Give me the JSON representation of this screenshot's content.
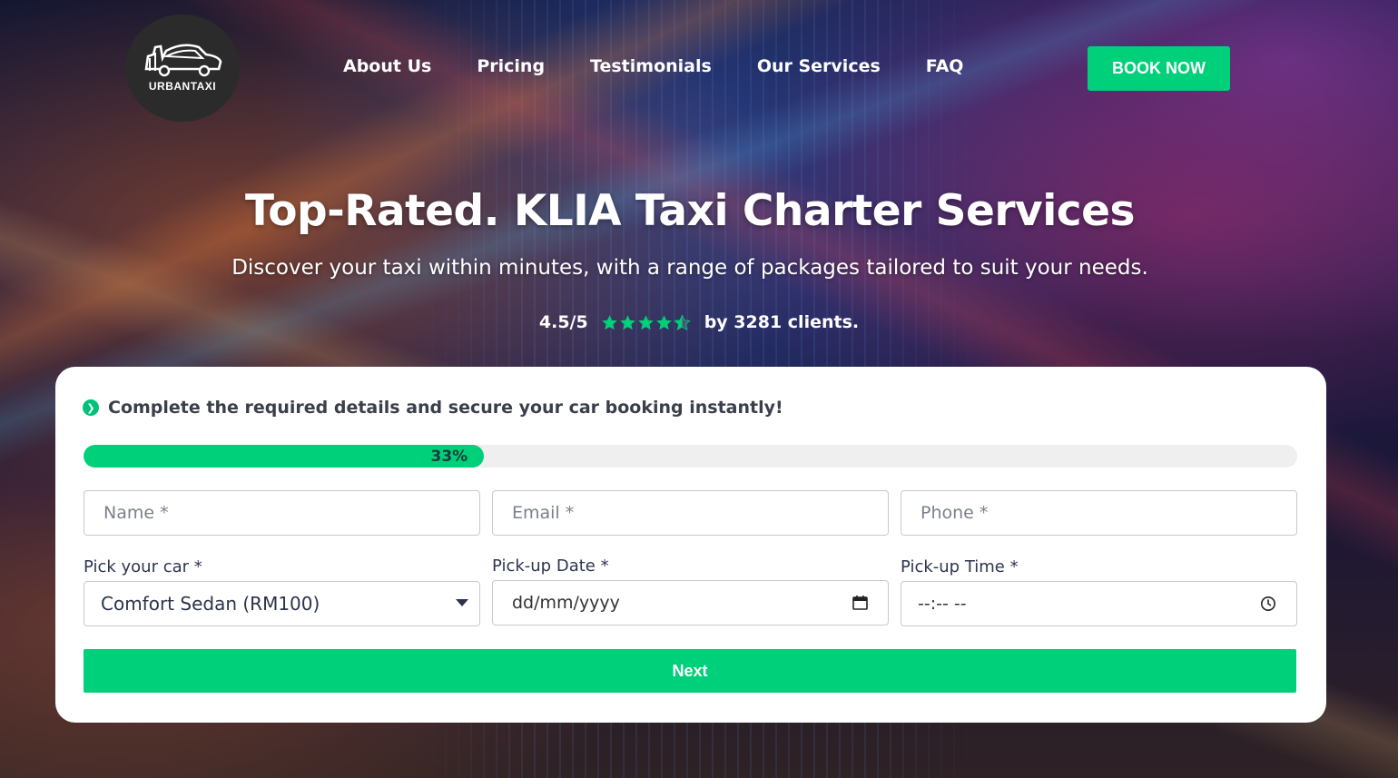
{
  "brand": {
    "logo_text": "URBANTAXI"
  },
  "nav": {
    "items": [
      {
        "label": "About Us"
      },
      {
        "label": "Pricing"
      },
      {
        "label": "Testimonials"
      },
      {
        "label": "Our Services"
      },
      {
        "label": "FAQ"
      }
    ],
    "cta_label": "BOOK NOW"
  },
  "hero": {
    "title": "Top-Rated. KLIA Taxi Charter Services",
    "subtitle": "Discover your taxi within minutes, with a range of packages tailored to suit your needs.",
    "rating_score": "4.5/5",
    "rating_stars": 4.5,
    "rating_text": "by 3281 clients."
  },
  "form": {
    "notice": "Complete the required details and secure your car booking instantly!",
    "progress_label": "33%",
    "progress_value": 33,
    "name_placeholder": "Name *",
    "email_placeholder": "Email *",
    "phone_placeholder": "Phone *",
    "car_label": "Pick your car *",
    "car_selected": "Comfort Sedan (RM100)",
    "date_label": "Pick-up Date *",
    "date_value": "dd/mm/yyyy",
    "time_label": "Pick-up Time *",
    "time_value": "--:-- --",
    "next_label": "Next"
  },
  "colors": {
    "accent": "#00d07a",
    "card": "#ffffff"
  }
}
